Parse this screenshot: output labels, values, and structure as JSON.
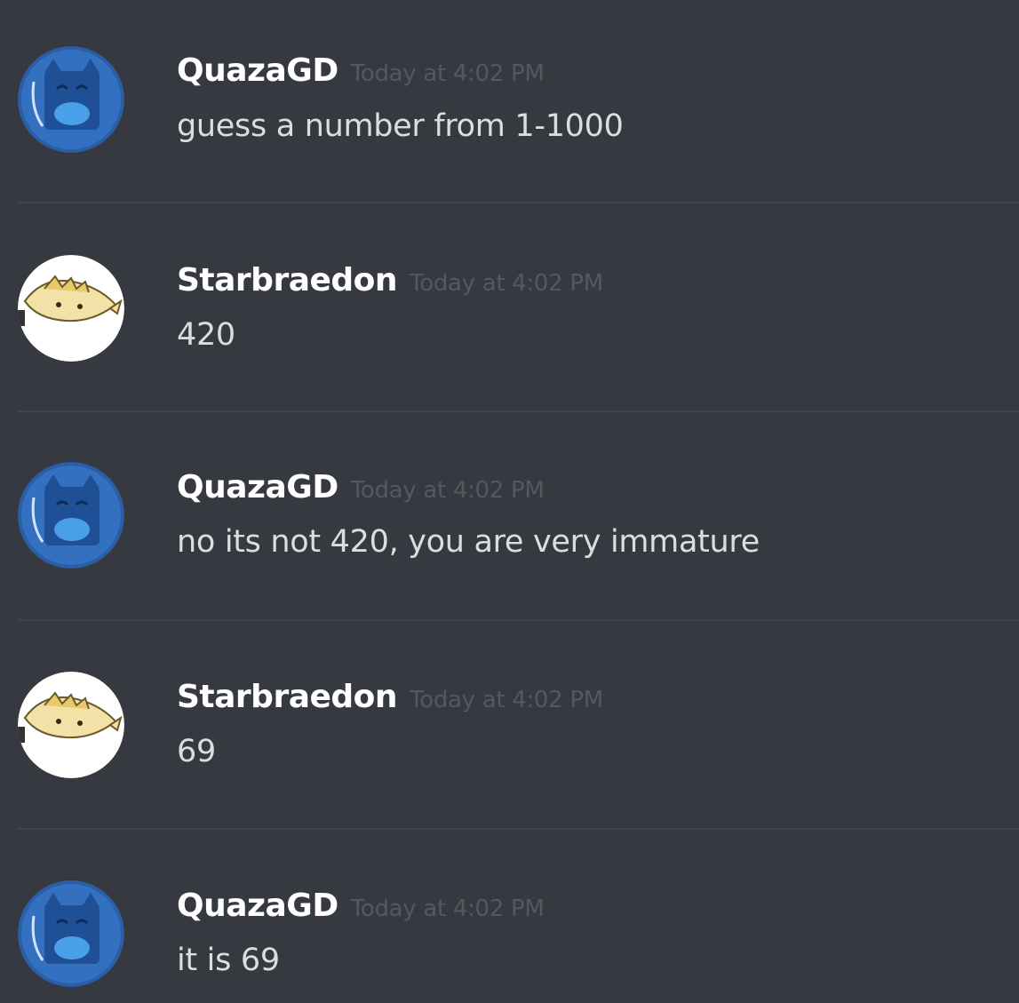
{
  "messages": [
    {
      "author": "QuazaGD",
      "avatar": "blue-cat-avatar",
      "timestamp": "Today at 4:02 PM",
      "content": "guess a number from 1-1000"
    },
    {
      "author": "Starbraedon",
      "avatar": "yellow-creature-avatar",
      "timestamp": "Today at 4:02 PM",
      "content": "420"
    },
    {
      "author": "QuazaGD",
      "avatar": "blue-cat-avatar",
      "timestamp": "Today at 4:02 PM",
      "content": "no its not 420, you are very immature"
    },
    {
      "author": "Starbraedon",
      "avatar": "yellow-creature-avatar",
      "timestamp": "Today at 4:02 PM",
      "content": "69"
    },
    {
      "author": "QuazaGD",
      "avatar": "blue-cat-avatar",
      "timestamp": "Today at 4:02 PM",
      "content": "it is 69"
    }
  ],
  "colors": {
    "background": "#36393f",
    "username": "#ffffff",
    "message_text": "#dcddde",
    "timestamp": "#55585f",
    "divider": "#40434a"
  }
}
